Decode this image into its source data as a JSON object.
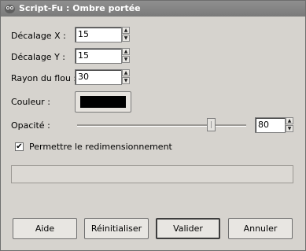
{
  "window": {
    "title": "Script-Fu : Ombre portée"
  },
  "form": {
    "offset_x": {
      "label": "Décalage X :",
      "value": "15"
    },
    "offset_y": {
      "label": "Décalage Y :",
      "value": "15"
    },
    "blur_radius": {
      "label": "Rayon du flou :",
      "value": "30"
    },
    "color": {
      "label": "Couleur :",
      "value": "#000000"
    },
    "opacity": {
      "label": "Opacité :",
      "value": "80",
      "min": 0,
      "max": 100
    },
    "resize": {
      "label": "Permettre le redimensionnement",
      "checked": true
    }
  },
  "progress": {
    "value": 0
  },
  "buttons": {
    "help": "Aide",
    "reset": "Réinitialiser",
    "ok": "Valider",
    "cancel": "Annuler"
  }
}
